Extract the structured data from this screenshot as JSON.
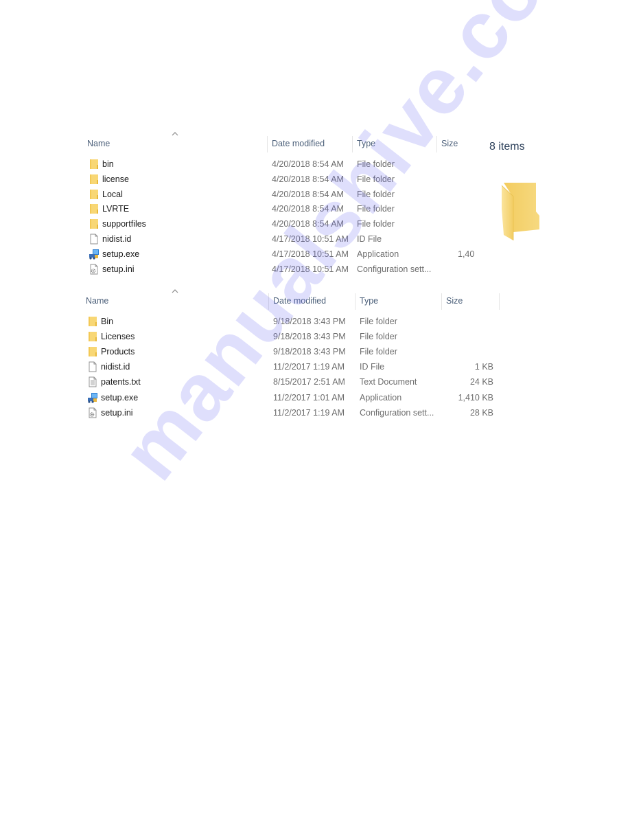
{
  "list1": {
    "columns": {
      "name": "Name",
      "date": "Date modified",
      "type": "Type",
      "size": "Size"
    },
    "rows": [
      {
        "icon": "folder-icon",
        "name": "bin",
        "date": "4/20/2018 8:54 AM",
        "type": "File folder",
        "size": ""
      },
      {
        "icon": "folder-icon",
        "name": "license",
        "date": "4/20/2018 8:54 AM",
        "type": "File folder",
        "size": ""
      },
      {
        "icon": "folder-icon",
        "name": "Local",
        "date": "4/20/2018 8:54 AM",
        "type": "File folder",
        "size": ""
      },
      {
        "icon": "folder-icon",
        "name": "LVRTE",
        "date": "4/20/2018 8:54 AM",
        "type": "File folder",
        "size": ""
      },
      {
        "icon": "folder-icon",
        "name": "supportfiles",
        "date": "4/20/2018 8:54 AM",
        "type": "File folder",
        "size": ""
      },
      {
        "icon": "file-icon",
        "name": "nidist.id",
        "date": "4/17/2018 10:51 AM",
        "type": "ID File",
        "size": ""
      },
      {
        "icon": "installer-icon",
        "name": "setup.exe",
        "date": "4/17/2018 10:51 AM",
        "type": "Application",
        "size": "1,40"
      },
      {
        "icon": "settings-file-icon",
        "name": "setup.ini",
        "date": "4/17/2018 10:51 AM",
        "type": "Configuration sett...",
        "size": ""
      }
    ]
  },
  "details_pane": {
    "items_count": "8 items",
    "icon": "folder-icon"
  },
  "list2": {
    "columns": {
      "name": "Name",
      "date": "Date modified",
      "type": "Type",
      "size": "Size"
    },
    "rows": [
      {
        "icon": "folder-icon",
        "name": "Bin",
        "date": "9/18/2018 3:43 PM",
        "type": "File folder",
        "size": ""
      },
      {
        "icon": "folder-icon",
        "name": "Licenses",
        "date": "9/18/2018 3:43 PM",
        "type": "File folder",
        "size": ""
      },
      {
        "icon": "folder-icon",
        "name": "Products",
        "date": "9/18/2018 3:43 PM",
        "type": "File folder",
        "size": ""
      },
      {
        "icon": "file-icon",
        "name": "nidist.id",
        "date": "11/2/2017 1:19 AM",
        "type": "ID File",
        "size": "1 KB"
      },
      {
        "icon": "text-file-icon",
        "name": "patents.txt",
        "date": "8/15/2017 2:51 AM",
        "type": "Text Document",
        "size": "24 KB"
      },
      {
        "icon": "installer-icon",
        "name": "setup.exe",
        "date": "11/2/2017 1:01 AM",
        "type": "Application",
        "size": "1,410 KB"
      },
      {
        "icon": "settings-file-icon",
        "name": "setup.ini",
        "date": "11/2/2017 1:19 AM",
        "type": "Configuration sett...",
        "size": "28 KB"
      }
    ]
  },
  "watermark": "manualshive.com",
  "colors": {
    "header_text": "#4c607a",
    "name_text": "#1a1a1a",
    "detail_text": "#6d6d6d",
    "folder_yellow": "#f8d775"
  }
}
